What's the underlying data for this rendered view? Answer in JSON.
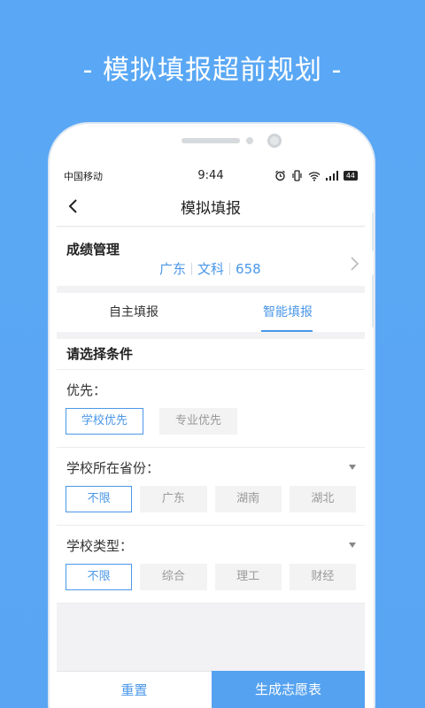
{
  "headline": "- 模拟填报超前规划 -",
  "status": {
    "carrier": "中国移动",
    "time": "9:44",
    "battery": "44"
  },
  "nav": {
    "title": "模拟填报"
  },
  "score": {
    "label": "成绩管理",
    "province": "广东",
    "subject": "文科",
    "value": "658"
  },
  "tabs": [
    {
      "label": "自主填报"
    },
    {
      "label": "智能填报"
    }
  ],
  "conditions": {
    "title": "请选择条件",
    "priority": {
      "label": "优先：",
      "options": [
        "学校优先",
        "专业优先"
      ]
    },
    "province": {
      "label": "学校所在省份：",
      "options": [
        "不限",
        "广东",
        "湖南",
        "湖北"
      ]
    },
    "type": {
      "label": "学校类型：",
      "options": [
        "不限",
        "综合",
        "理工",
        "财经"
      ]
    }
  },
  "footer": {
    "reset": "重置",
    "generate": "生成志愿表"
  },
  "colors": {
    "accent": "#4a97e8",
    "background": "#5aa8f5"
  }
}
